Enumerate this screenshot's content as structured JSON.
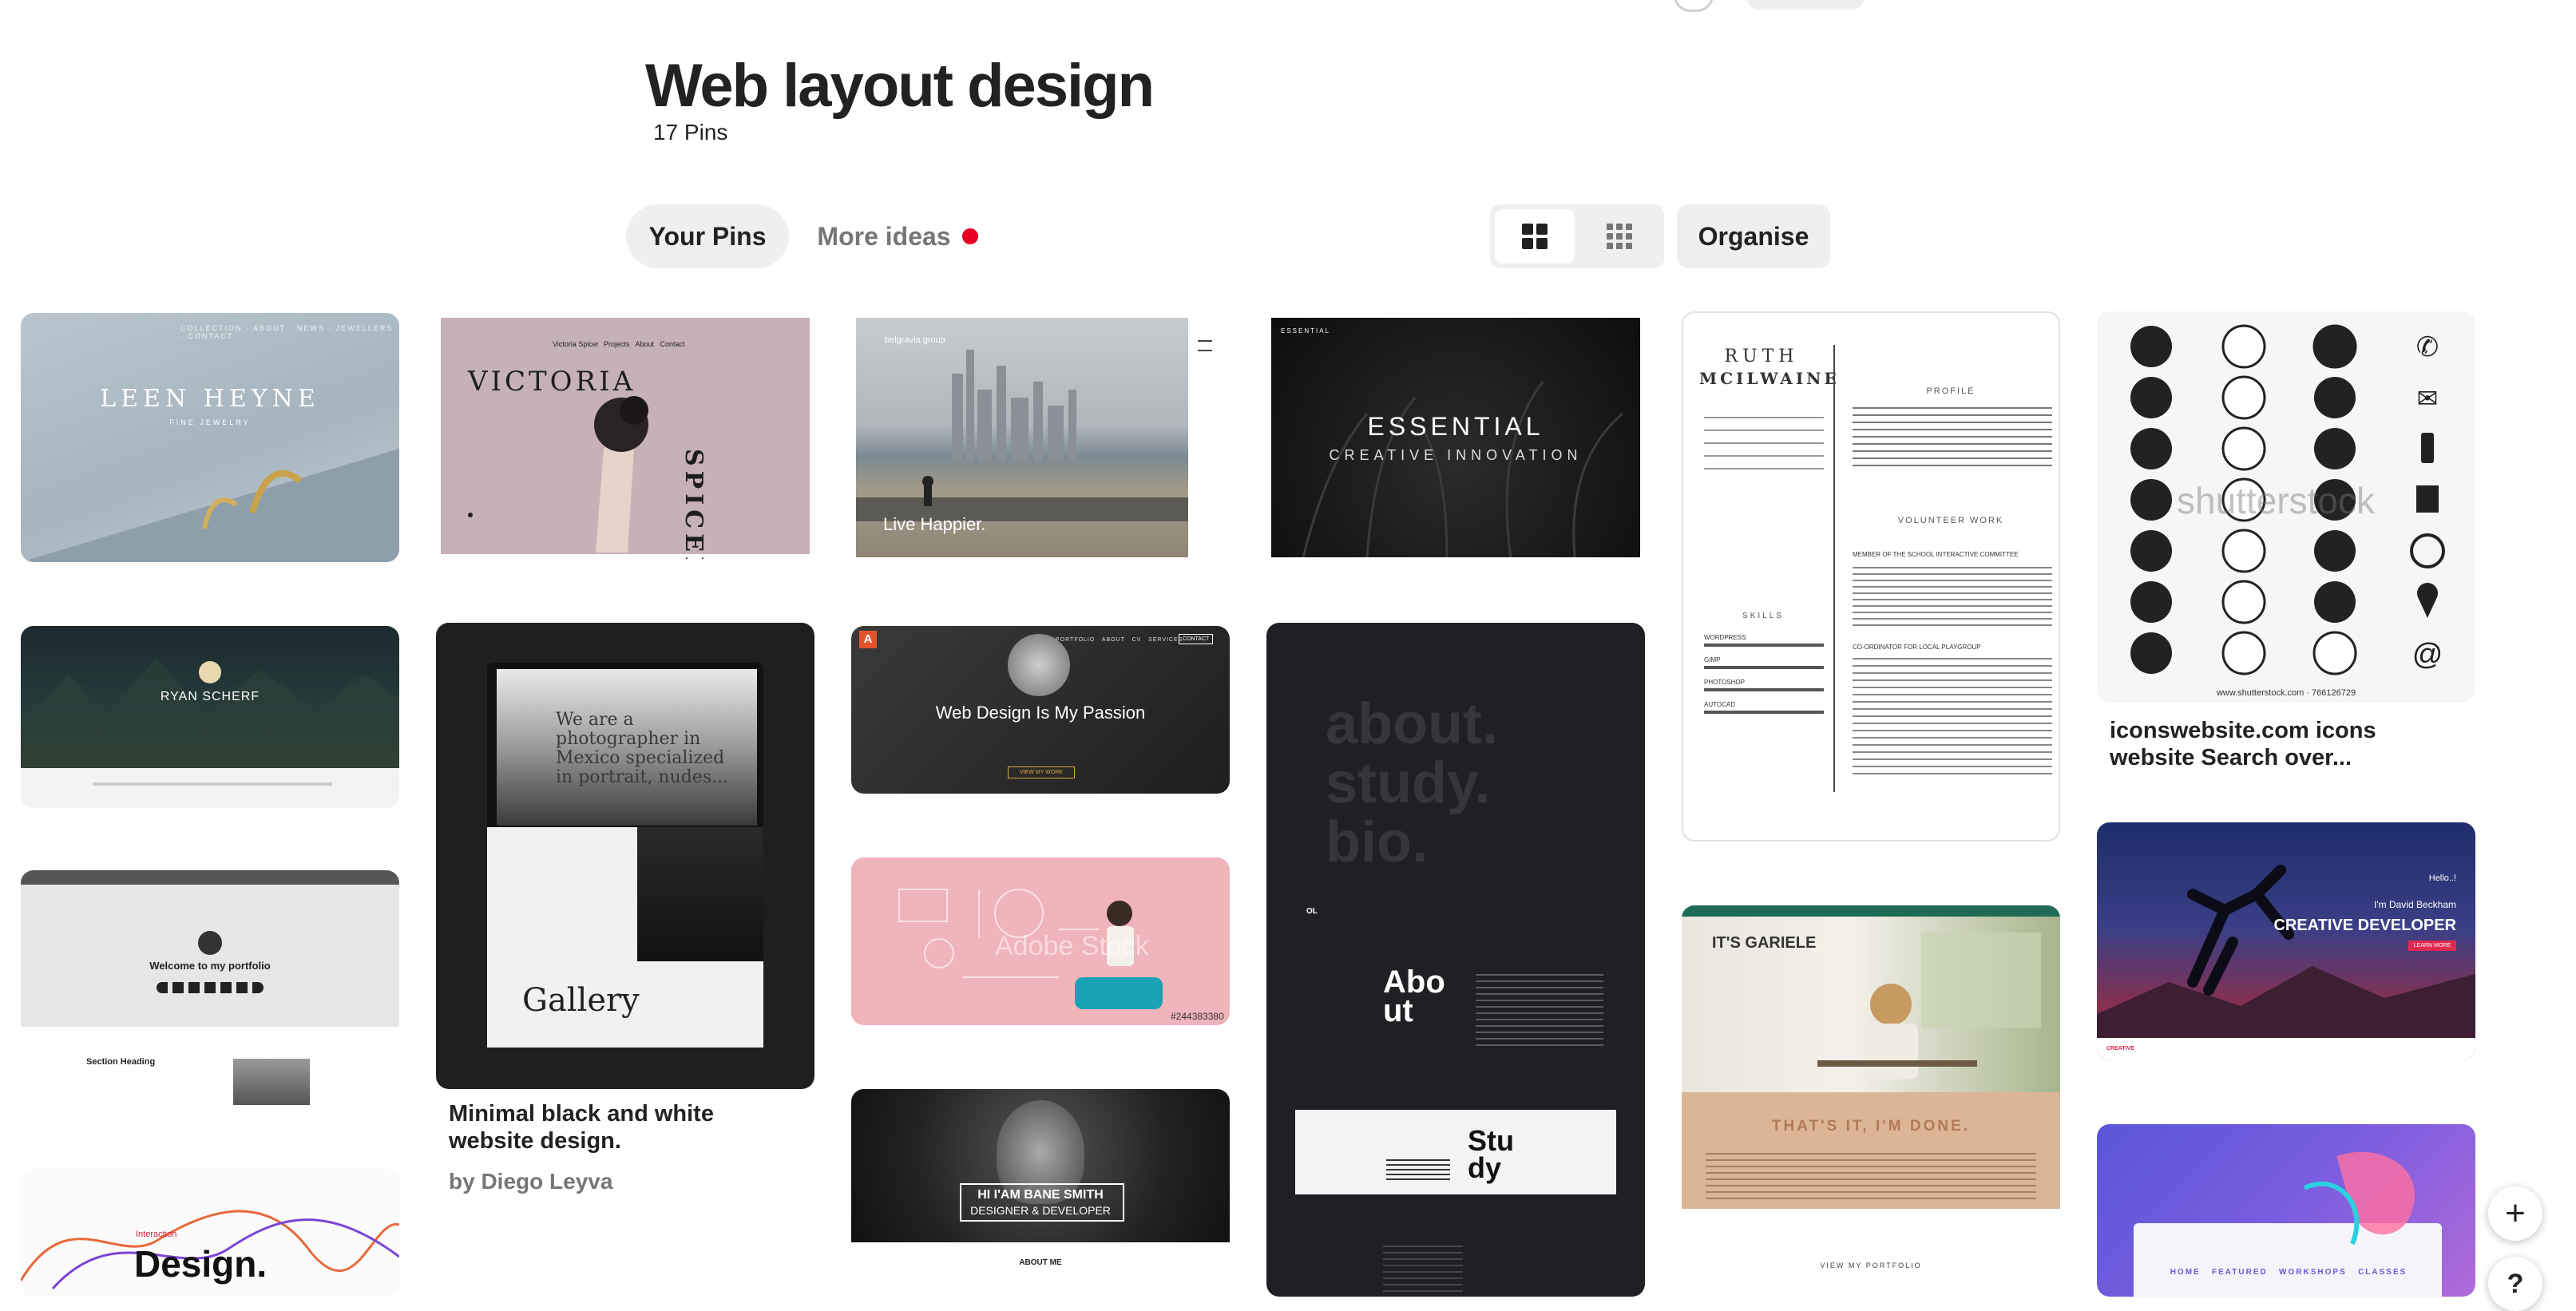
{
  "board": {
    "title": "Web layout design",
    "pin_count": "17 Pins"
  },
  "tabs": {
    "your_pins": "Your Pins",
    "more_ideas": "More ideas"
  },
  "toolbar": {
    "organise": "Organise"
  },
  "pins": {
    "leen_heyne": {
      "brand": "LEEN HEYNE",
      "tagline": "FINE JEWELRY",
      "nav": "COLLECTION · ABOUT · NEWS · JEWELLERS · CONTACT"
    },
    "victoria": {
      "name": "VICTORIA",
      "vertical": "SPICER",
      "nav_brand": "Victoria Spicer",
      "nav": "Projects   About   Contact"
    },
    "belgravia": {
      "brand": "belgravia group",
      "caption": "Live Happier."
    },
    "essential": {
      "brand": "ESSENTIAL",
      "title": "ESSENTIAL",
      "subtitle": "CREATIVE INNOVATION"
    },
    "resume": {
      "first": "RUTH",
      "last": "MCILWAINE",
      "profile": "PROFILE",
      "volunteer": "VOLUNTEER WORK",
      "skills": "SKILLS",
      "skill_items": [
        "WORDPRESS",
        "GIMP",
        "PHOTOSHOP",
        "AUTOCAD"
      ],
      "role_a": "MEMBER OF THE SCHOOL INTERACTIVE COMMITTEE",
      "role_b": "CO-ORDINATOR FOR LOCAL PLAYGROUP"
    },
    "icons": {
      "watermark": "shutterstock",
      "footer": "www.shutterstock.com · 766126729",
      "title": "iconswebsite.com icons website Search over..."
    },
    "ryan": {
      "name": "RYAN SCHERF"
    },
    "gallery": {
      "word": "Gallery",
      "hero": "We are a photographer in Mexico specialized in portrait, nudes...",
      "title": "Minimal black and white website design.",
      "author": "by Diego Leyva"
    },
    "passion": {
      "logo": "A",
      "headline": "Web Design Is My Passion",
      "button": "VIEW MY WORK",
      "nav": "PORTFOLIO   ABOUT   CV   SERVICES",
      "contact": "CONTACT"
    },
    "about_study": {
      "big": [
        "about.",
        "study.",
        "bio."
      ],
      "about": "Abo ut",
      "study": "Stu dy",
      "tag": "OL"
    },
    "developer": {
      "hello": "Hello..!",
      "name": "I'm David Beckham",
      "title": "CREATIVE DEVELOPER",
      "button": "LEARN MORE",
      "brand": "CREATIVE"
    },
    "portfolio": {
      "welcome": "Welcome to my portfolio",
      "section": "Section Heading"
    },
    "pink": {
      "watermark": "Adobe Stock",
      "stock_id": "#244383380"
    },
    "gariele": {
      "brand": "IT'S GARIELE",
      "done": "THAT'S IT, I'M DONE.",
      "view": "VIEW MY PORTFOLIO"
    },
    "design": {
      "small": "Interaction",
      "big": "Design."
    },
    "bane": {
      "line1": "HI I'AM BANE SMITH",
      "line2": "DESIGNER & DEVELOPER",
      "about": "ABOUT ME"
    },
    "purple": {
      "nav": "HOME   FEATURED   WORKSHOPS   CLASSES"
    }
  },
  "fab": {
    "add": "+",
    "help": "?"
  },
  "icon_names": [
    "grid-large-icon",
    "grid-small-icon",
    "plus-icon",
    "help-icon",
    "phone-icon",
    "mail-icon",
    "mobile-icon",
    "globe-icon",
    "pin-icon",
    "at-icon"
  ]
}
